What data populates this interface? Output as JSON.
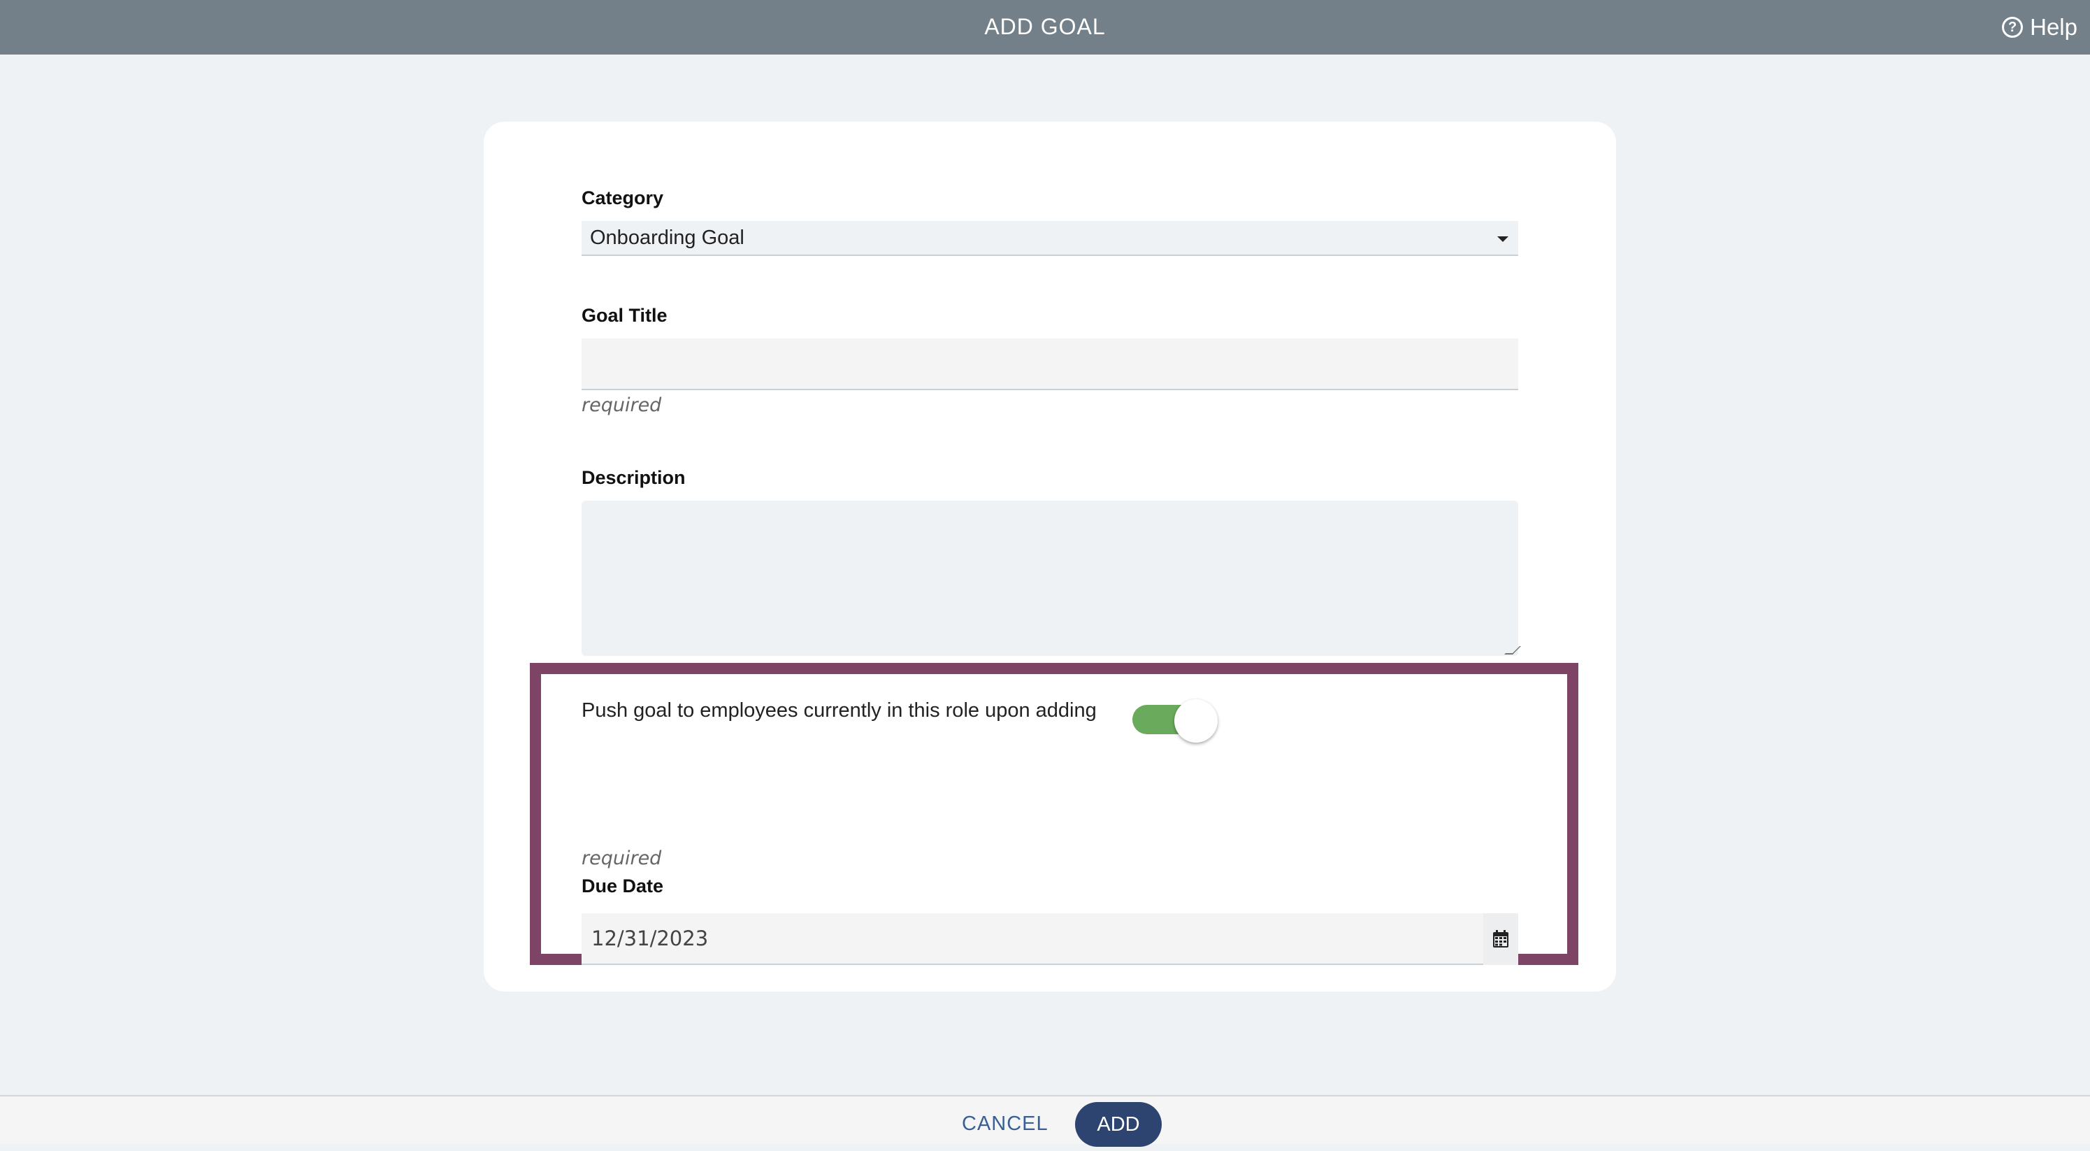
{
  "header": {
    "title": "ADD GOAL",
    "help_label": "Help",
    "help_icon": "question-circle-icon"
  },
  "form": {
    "category": {
      "label": "Category",
      "selected": "Onboarding Goal"
    },
    "goal_title": {
      "label": "Goal Title",
      "value": "",
      "hint": "required"
    },
    "description": {
      "label": "Description",
      "value": ""
    },
    "push_goal": {
      "label": "Push goal to employees currently in this role upon adding",
      "enabled": true
    },
    "due_date": {
      "label": "Due Date",
      "value": "12/31/2023",
      "hint": "required",
      "icon": "calendar-icon"
    }
  },
  "footer": {
    "cancel_label": "CANCEL",
    "add_label": "ADD"
  },
  "colors": {
    "header_bg": "#738089",
    "highlight_border": "#7e4466",
    "toggle_on": "#6aaa5c",
    "primary_button": "#2d4470",
    "link": "#3a5f95"
  }
}
